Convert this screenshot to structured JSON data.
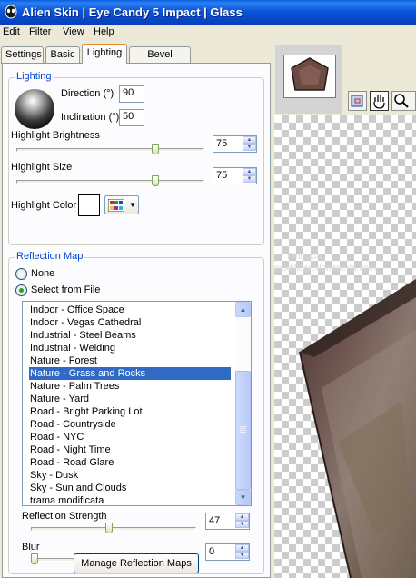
{
  "window": {
    "title": "Alien Skin  |  Eye Candy 5 Impact  |  Glass"
  },
  "menu": [
    "Edit",
    "Filter",
    "View",
    "Help"
  ],
  "tabs": [
    "Settings",
    "Basic",
    "Lighting",
    "Bevel Profile"
  ],
  "active_tab": "Lighting",
  "lighting": {
    "group_title": "Lighting",
    "direction_label": "Direction (°)",
    "direction_value": "90",
    "inclination_label": "Inclination (°)",
    "inclination_value": "50",
    "highlight_brightness_label": "Highlight Brightness",
    "highlight_brightness_value": "75",
    "highlight_brightness_fraction": 0.75,
    "highlight_size_label": "Highlight Size",
    "highlight_size_value": "75",
    "highlight_size_fraction": 0.75,
    "highlight_color_label": "Highlight Color",
    "highlight_color": "#ffffff"
  },
  "reflection": {
    "group_title": "Reflection Map",
    "option_none": "None",
    "option_file": "Select from File",
    "selected_option": "Select from File",
    "maps": [
      "Indoor - Office Space",
      "Indoor - Vegas Cathedral",
      "Industrial - Steel Beams",
      "Industrial - Welding",
      "Nature - Forest",
      "Nature - Grass and Rocks",
      "Nature - Palm Trees",
      "Nature - Yard",
      "Road - Bright Parking Lot",
      "Road - Countryside",
      "Road - NYC",
      "Road - Night Time",
      "Road - Road Glare",
      "Sky - Dusk",
      "Sky - Sun and Clouds",
      "trama modificata"
    ],
    "selected_map": "Nature - Grass and Rocks",
    "strength_label": "Reflection Strength",
    "strength_value": "47",
    "strength_fraction": 0.47,
    "blur_label": "Blur",
    "blur_value": "0",
    "blur_fraction": 0,
    "manage_button": "Manage Reflection Maps"
  },
  "preview": {
    "watermark_line1": "Pinuccia",
    "watermark_line2": "www.modificaredonaperla.com",
    "tools": [
      "navigator-icon",
      "hand-icon",
      "zoom-icon"
    ]
  },
  "colors": {
    "title_bar": "#0a5fe0",
    "selection": "#316ac5",
    "group_title": "#0046d5",
    "glass_object": "#5b4440"
  }
}
